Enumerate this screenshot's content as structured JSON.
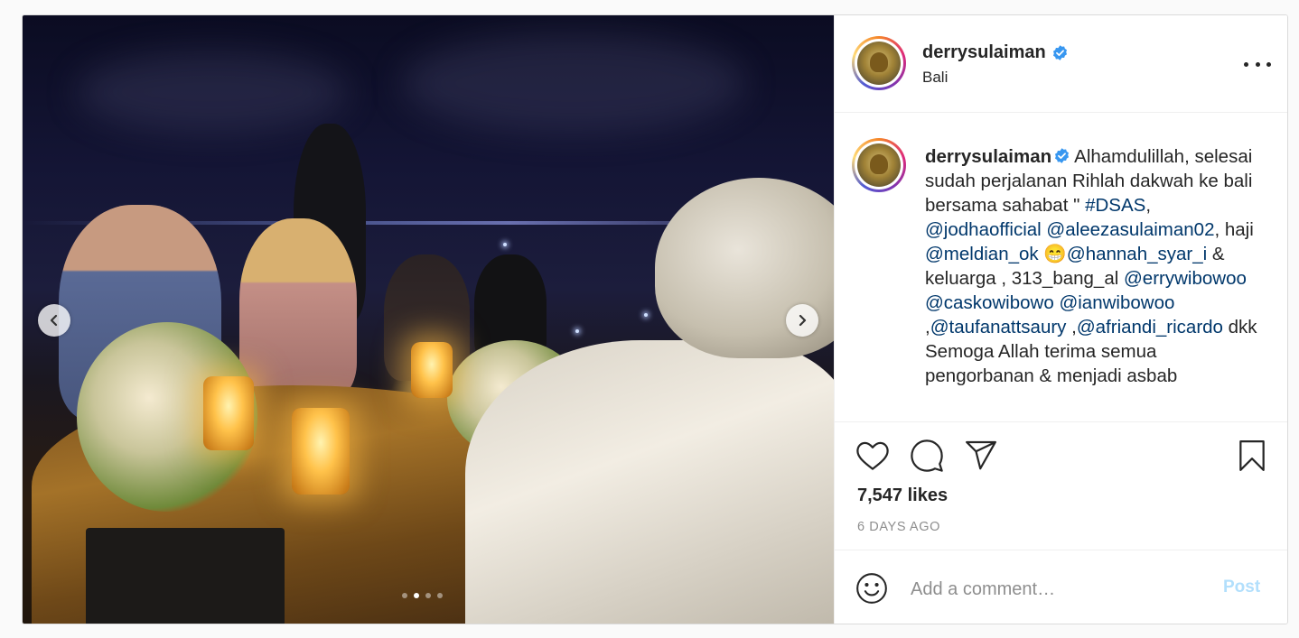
{
  "post": {
    "username": "derrysulaiman",
    "verified": true,
    "location": "Bali",
    "media": {
      "carousel_index": 2,
      "carousel_total": 4,
      "prev_icon": "chevron-left-icon",
      "next_icon": "chevron-right-icon"
    },
    "caption": {
      "username": "derrysulaiman",
      "segments": [
        {
          "text": "Alhamdulillah, selesai sudah perjalanan Rihlah dakwah ke bali bersama sahabat \" ",
          "type": "text"
        },
        {
          "text": "#DSAS",
          "type": "tag"
        },
        {
          "text": ", ",
          "type": "text"
        },
        {
          "text": "@jodhaofficial",
          "type": "tag"
        },
        {
          "text": " ",
          "type": "text"
        },
        {
          "text": "@aleezasulaiman02",
          "type": "tag"
        },
        {
          "text": ", haji ",
          "type": "text"
        },
        {
          "text": "@meldian_ok",
          "type": "tag"
        },
        {
          "text": " 😁",
          "type": "text"
        },
        {
          "text": "@hannah_syar_i",
          "type": "tag"
        },
        {
          "text": " & keluarga , 313_bang_al ",
          "type": "text"
        },
        {
          "text": "@errywibowoo",
          "type": "tag"
        },
        {
          "text": " ",
          "type": "text"
        },
        {
          "text": "@caskowibowo",
          "type": "tag"
        },
        {
          "text": " ",
          "type": "text"
        },
        {
          "text": "@ianwibowoo",
          "type": "tag"
        },
        {
          "text": " ,",
          "type": "text"
        },
        {
          "text": "@taufanattsaury",
          "type": "tag"
        },
        {
          "text": " ,",
          "type": "text"
        },
        {
          "text": "@afriandi_ricardo",
          "type": "tag"
        },
        {
          "text": " dkk Semoga Allah terima semua pengorbanan & menjadi asbab",
          "type": "text"
        }
      ]
    },
    "likes": "7,547 likes",
    "time_ago": "6 DAYS AGO",
    "comment": {
      "placeholder": "Add a comment…",
      "post_label": "Post"
    },
    "icons": {
      "like": "heart-icon",
      "comment": "comment-bubble-icon",
      "share": "paper-plane-icon",
      "save": "bookmark-icon",
      "emoji": "smiley-icon",
      "more": "more-options-icon"
    },
    "colors": {
      "link": "#00376b",
      "verified": "#3897f0",
      "post_button": "#b2dffc",
      "muted": "#8e8e8e"
    }
  }
}
